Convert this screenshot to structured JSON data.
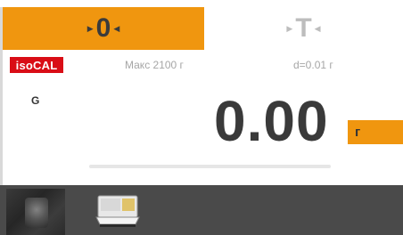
{
  "tabs": {
    "zero": {
      "label": "0",
      "active": true
    },
    "tare": {
      "label": "T",
      "active": false
    }
  },
  "badge": {
    "label": "isoCAL"
  },
  "info": {
    "max": "Макс 2100 г",
    "d": "d=0.01 г"
  },
  "mode": "G",
  "reading": {
    "value": "0.00",
    "unit": "г"
  },
  "capacity": {
    "fraction": 0.0
  },
  "colors": {
    "accent": "#f0960f",
    "badge": "#d90d16",
    "text": "#3a3a3a",
    "taskbar": "#4a4a4a"
  },
  "taskbar": {
    "items": [
      {
        "icon": "camera-thumbnail-icon"
      },
      {
        "icon": "balance-scale-icon"
      }
    ]
  }
}
